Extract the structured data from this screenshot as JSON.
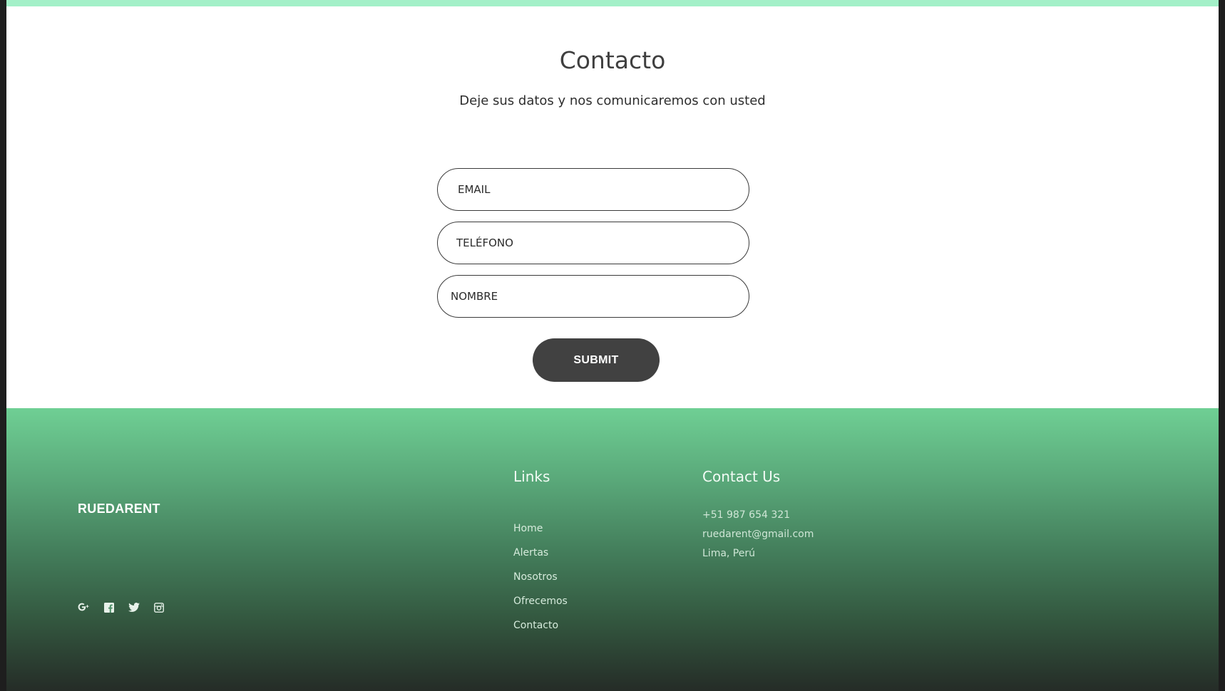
{
  "contact": {
    "title": "Contacto",
    "subtitle": "Deje sus datos y nos comunicaremos con usted",
    "email_placeholder": "EMAIL",
    "phone_placeholder": "TELÉFONO",
    "name_placeholder": "NOMBRE",
    "submit_label": "SUBMIT"
  },
  "footer": {
    "brand": "RUEDARENT",
    "social": [
      {
        "icon": "google-plus-icon"
      },
      {
        "icon": "facebook-icon"
      },
      {
        "icon": "twitter-icon"
      },
      {
        "icon": "instagram-icon"
      }
    ],
    "links_title": "Links",
    "links": [
      "Home",
      "Alertas",
      "Nosotros",
      "Ofrecemos",
      "Contacto"
    ],
    "contact_title": "Contact Us",
    "contact_items": [
      "+51 987 654 321",
      "ruedarent@gmail.com",
      "Lima, Perú"
    ]
  },
  "colors": {
    "accent": "#a3f0c8",
    "footer_top": "#6fcf94",
    "footer_bottom": "#252c27",
    "button": "#414141",
    "text": "#3f3f3f"
  }
}
